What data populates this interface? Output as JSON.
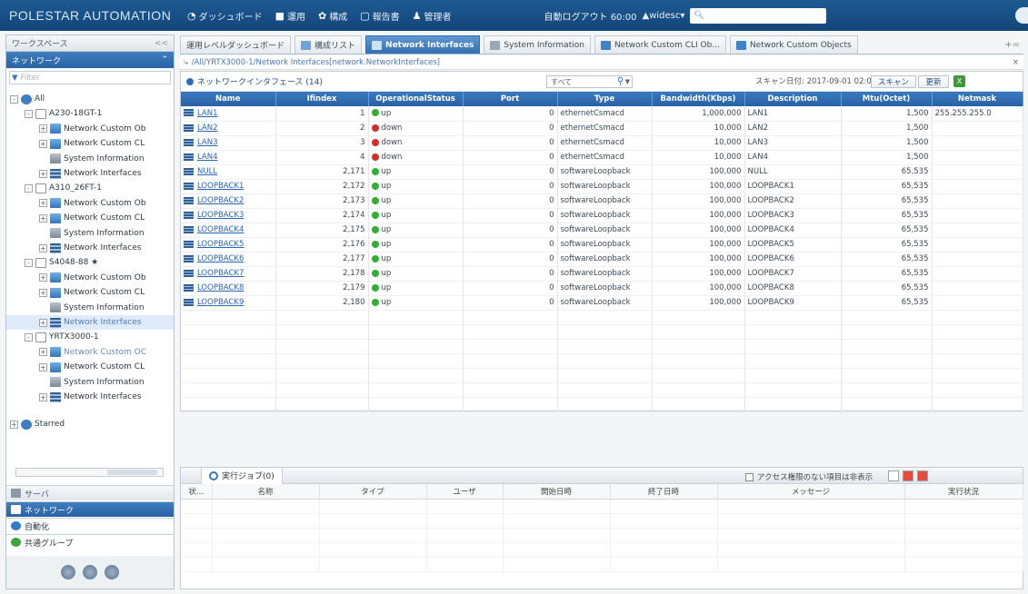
{
  "topbar": {
    "brand": "POLESTAR AUTOMATION",
    "nav": [
      {
        "label": "ダッシュボード",
        "icon": "dashboard-icon"
      },
      {
        "label": "運用",
        "icon": "operation-icon"
      },
      {
        "label": "構成",
        "icon": "config-icon"
      },
      {
        "label": "報告書",
        "icon": "report-icon"
      },
      {
        "label": "管理者",
        "icon": "admin-icon"
      }
    ],
    "session": "自動ログアウト 60:00",
    "user": "▲widesc▾"
  },
  "left": {
    "workspace_label": "ワークスペース",
    "collapse": "<<",
    "network_label": "ネットワーク",
    "filter_placeholder": "Filter",
    "tree": [
      {
        "label": "All",
        "level": 0,
        "type": "all",
        "expand": "-"
      },
      {
        "label": "A230-18GT-1",
        "level": 1,
        "type": "device",
        "expand": "-"
      },
      {
        "label": "Network Custom Ob",
        "level": 2,
        "type": "custom",
        "expand": "+"
      },
      {
        "label": "Network Custom CL",
        "level": 2,
        "type": "custom",
        "expand": "+"
      },
      {
        "label": "System Information",
        "level": 2,
        "type": "sysinfo",
        "expand": ""
      },
      {
        "label": "Network Interfaces",
        "level": 2,
        "type": "netif",
        "expand": "+"
      },
      {
        "label": "A310_26FT-1",
        "level": 1,
        "type": "device",
        "expand": "-"
      },
      {
        "label": "Network Custom Ob",
        "level": 2,
        "type": "custom",
        "expand": "+"
      },
      {
        "label": "Network Custom CL",
        "level": 2,
        "type": "custom",
        "expand": "+"
      },
      {
        "label": "System Information",
        "level": 2,
        "type": "sysinfo",
        "expand": ""
      },
      {
        "label": "Network Interfaces",
        "level": 2,
        "type": "netif",
        "expand": "+"
      },
      {
        "label": "S4048-88 ★",
        "level": 1,
        "type": "device",
        "expand": "-"
      },
      {
        "label": "Network Custom Ob",
        "level": 2,
        "type": "custom",
        "expand": "+"
      },
      {
        "label": "Network Custom CL",
        "level": 2,
        "type": "custom",
        "expand": "+"
      },
      {
        "label": "System Information",
        "level": 2,
        "type": "sysinfo",
        "expand": ""
      },
      {
        "label": "Network Interfaces",
        "level": 2,
        "type": "netif",
        "expand": "+",
        "selected": true
      },
      {
        "label": "YRTX3000-1",
        "level": 1,
        "type": "device",
        "expand": "-"
      },
      {
        "label": "Network Custom OC",
        "level": 2,
        "type": "custom",
        "expand": "+",
        "highlight": true
      },
      {
        "label": "Network Custom CL",
        "level": 2,
        "type": "custom",
        "expand": "+"
      },
      {
        "label": "System Information",
        "level": 2,
        "type": "sysinfo",
        "expand": ""
      },
      {
        "label": "Network Interfaces",
        "level": 2,
        "type": "netif",
        "expand": "+"
      },
      {
        "label": "Starred",
        "level": 0,
        "type": "all",
        "expand": "+"
      }
    ],
    "accordions": [
      {
        "label": "サーバ",
        "style": "gray"
      },
      {
        "label": "ネットワーク",
        "style": "blue"
      },
      {
        "label": "自動化",
        "style": "white"
      },
      {
        "label": "共通グループ",
        "style": "white"
      }
    ]
  },
  "tabs": [
    {
      "label": "運用レベルダッシュボード",
      "active": false,
      "icon": "dashboard-icon"
    },
    {
      "label": "構成リスト",
      "active": false,
      "icon": "config-list-icon"
    },
    {
      "label": "Network Interfaces",
      "active": true,
      "icon": "network-interfaces-icon"
    },
    {
      "label": "System Information",
      "active": false,
      "icon": "system-info-icon"
    },
    {
      "label": "Network Custom CLI Ob...",
      "active": false,
      "icon": "custom-cli-icon"
    },
    {
      "label": "Network Custom Objects",
      "active": false,
      "icon": "custom-objects-icon"
    }
  ],
  "tab_more": "+=",
  "breadcrumb": "/All/YRTX3000-1/Network Interfaces[network.NetworkInterfaces]",
  "grid": {
    "title": "ネットワークインタフェース (14)",
    "filter_value": "すべて",
    "scan_date": "スキャン日付: 2017-09-01 02:00:00",
    "scan_button": "スキャン",
    "update_button": "更新",
    "columns": [
      "Name",
      "Ifindex",
      "OperationalStatus",
      "Port",
      "Type",
      "Bandwidth(Kbps)",
      "Description",
      "Mtu(Octet)",
      "Netmask"
    ],
    "rows": [
      {
        "name": "LAN1",
        "ifindex": "1",
        "status": "up",
        "port": "0",
        "type": "ethernetCsmacd",
        "bandwidth": "1,000,000",
        "description": "LAN1",
        "mtu": "1,500",
        "netmask": "255.255.255.0"
      },
      {
        "name": "LAN2",
        "ifindex": "2",
        "status": "down",
        "port": "0",
        "type": "ethernetCsmacd",
        "bandwidth": "10,000",
        "description": "LAN2",
        "mtu": "1,500",
        "netmask": ""
      },
      {
        "name": "LAN3",
        "ifindex": "3",
        "status": "down",
        "port": "0",
        "type": "ethernetCsmacd",
        "bandwidth": "10,000",
        "description": "LAN3",
        "mtu": "1,500",
        "netmask": ""
      },
      {
        "name": "LAN4",
        "ifindex": "4",
        "status": "down",
        "port": "0",
        "type": "ethernetCsmacd",
        "bandwidth": "10,000",
        "description": "LAN4",
        "mtu": "1,500",
        "netmask": ""
      },
      {
        "name": "NULL",
        "ifindex": "2,171",
        "status": "up",
        "port": "0",
        "type": "softwareLoopback",
        "bandwidth": "100,000",
        "description": "NULL",
        "mtu": "65,535",
        "netmask": ""
      },
      {
        "name": "LOOPBACK1",
        "ifindex": "2,172",
        "status": "up",
        "port": "0",
        "type": "softwareLoopback",
        "bandwidth": "100,000",
        "description": "LOOPBACK1",
        "mtu": "65,535",
        "netmask": ""
      },
      {
        "name": "LOOPBACK2",
        "ifindex": "2,173",
        "status": "up",
        "port": "0",
        "type": "softwareLoopback",
        "bandwidth": "100,000",
        "description": "LOOPBACK2",
        "mtu": "65,535",
        "netmask": ""
      },
      {
        "name": "LOOPBACK3",
        "ifindex": "2,174",
        "status": "up",
        "port": "0",
        "type": "softwareLoopback",
        "bandwidth": "100,000",
        "description": "LOOPBACK3",
        "mtu": "65,535",
        "netmask": ""
      },
      {
        "name": "LOOPBACK4",
        "ifindex": "2,175",
        "status": "up",
        "port": "0",
        "type": "softwareLoopback",
        "bandwidth": "100,000",
        "description": "LOOPBACK4",
        "mtu": "65,535",
        "netmask": ""
      },
      {
        "name": "LOOPBACK5",
        "ifindex": "2,176",
        "status": "up",
        "port": "0",
        "type": "softwareLoopback",
        "bandwidth": "100,000",
        "description": "LOOPBACK5",
        "mtu": "65,535",
        "netmask": ""
      },
      {
        "name": "LOOPBACK6",
        "ifindex": "2,177",
        "status": "up",
        "port": "0",
        "type": "softwareLoopback",
        "bandwidth": "100,000",
        "description": "LOOPBACK6",
        "mtu": "65,535",
        "netmask": ""
      },
      {
        "name": "LOOPBACK7",
        "ifindex": "2,178",
        "status": "up",
        "port": "0",
        "type": "softwareLoopback",
        "bandwidth": "100,000",
        "description": "LOOPBACK7",
        "mtu": "65,535",
        "netmask": ""
      },
      {
        "name": "LOOPBACK8",
        "ifindex": "2,179",
        "status": "up",
        "port": "0",
        "type": "softwareLoopback",
        "bandwidth": "100,000",
        "description": "LOOPBACK8",
        "mtu": "65,535",
        "netmask": ""
      },
      {
        "name": "LOOPBACK9",
        "ifindex": "2,180",
        "status": "up",
        "port": "0",
        "type": "softwareLoopback",
        "bandwidth": "100,000",
        "description": "LOOPBACK9",
        "mtu": "65,535",
        "netmask": ""
      }
    ]
  },
  "jobs": {
    "tab_label": "実行ジョブ(0)",
    "hide_label": "アクセス権限のない項目は非表示",
    "columns": [
      "状...",
      "名称",
      "タイプ",
      "ユーザ",
      "開始日時",
      "終了日時",
      "メッセージ",
      "実行状況"
    ]
  },
  "colors": {
    "header_blue": "#2a62a6",
    "status_up": "#2fb12f",
    "status_down": "#d62d2d",
    "link": "#2b64b3"
  }
}
